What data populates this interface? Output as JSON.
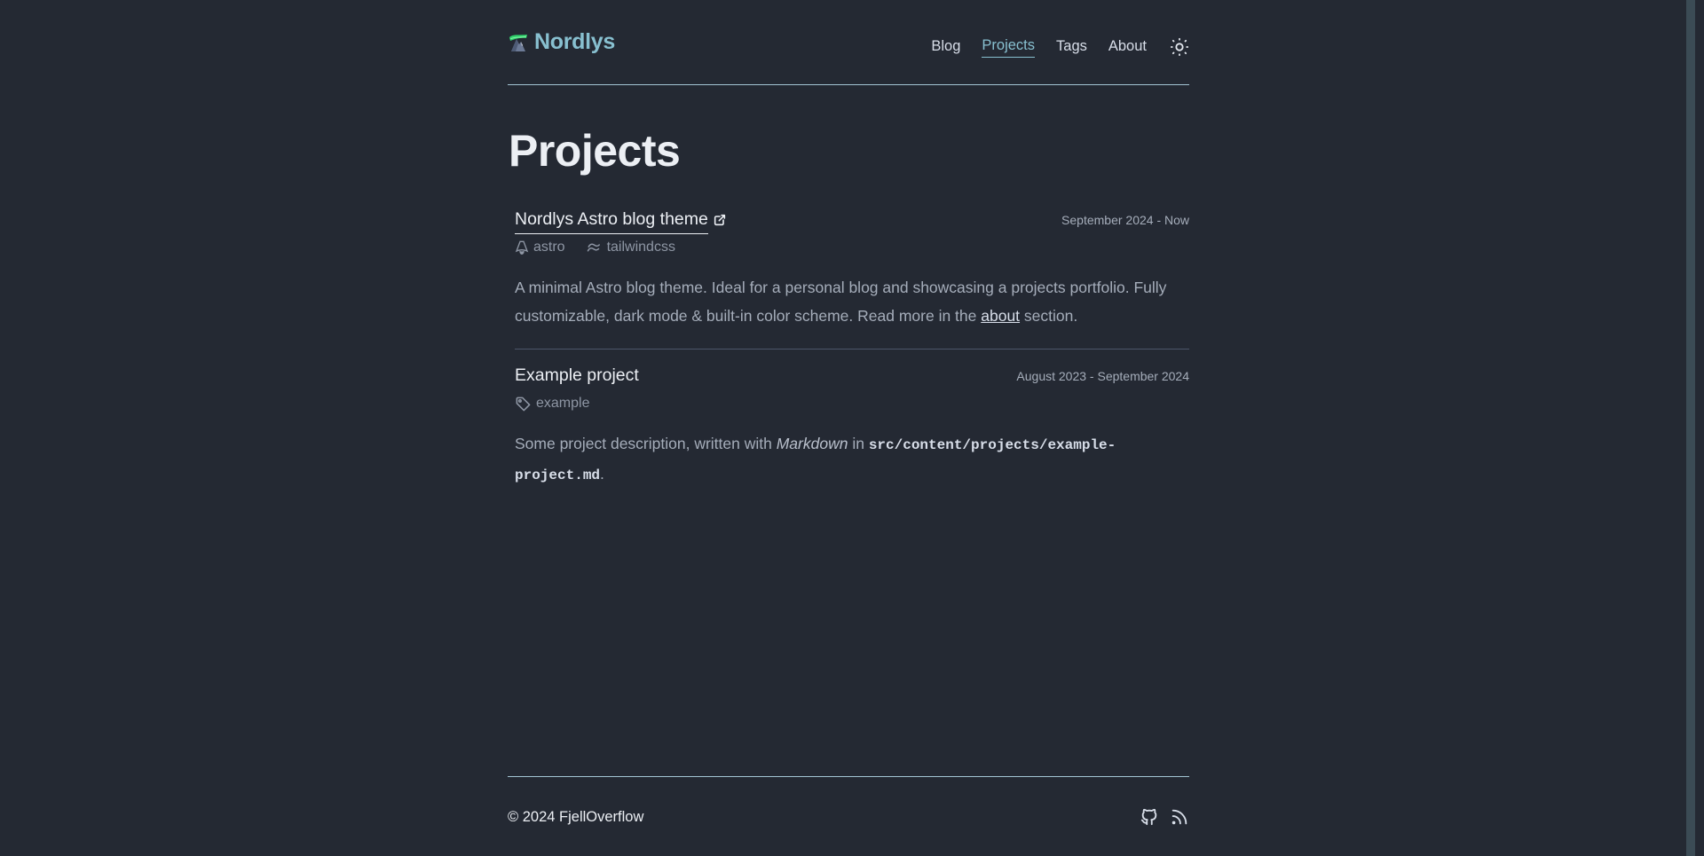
{
  "header": {
    "brand": "Nordlys",
    "logo_icon": "aurora-mountain-logo",
    "nav": [
      {
        "label": "Blog",
        "active": false
      },
      {
        "label": "Projects",
        "active": true
      },
      {
        "label": "Tags",
        "active": false
      },
      {
        "label": "About",
        "active": false
      }
    ],
    "theme_toggle_icon": "sun-icon"
  },
  "page": {
    "title": "Projects"
  },
  "projects": [
    {
      "title": "Nordlys Astro blog theme",
      "external_link": true,
      "date": "September 2024 - Now",
      "tags": [
        {
          "label": "astro",
          "icon": "astro-icon"
        },
        {
          "label": "tailwindcss",
          "icon": "tailwind-icon"
        }
      ],
      "description_part1": "A minimal Astro blog theme. Ideal for a personal blog and showcasing a projects portfolio. Fully customizable, dark mode & built-in color scheme. Read more in the ",
      "description_link": "about",
      "description_part2": " section."
    },
    {
      "title": "Example project",
      "external_link": false,
      "date": "August 2023 - September 2024",
      "tags": [
        {
          "label": "example",
          "icon": "tag-icon"
        }
      ],
      "description_part1": "Some project description, written with ",
      "description_em": "Markdown",
      "description_part2": " in ",
      "description_code": "src/content/projects/example-project.md",
      "description_part3": "."
    }
  ],
  "footer": {
    "copyright": "© 2024 FjellOverflow",
    "icons": [
      "github-icon",
      "rss-icon"
    ]
  },
  "colors": {
    "background": "#242933",
    "accent": "#88c0d0",
    "text": "#eceff4",
    "muted": "#a5adba"
  }
}
